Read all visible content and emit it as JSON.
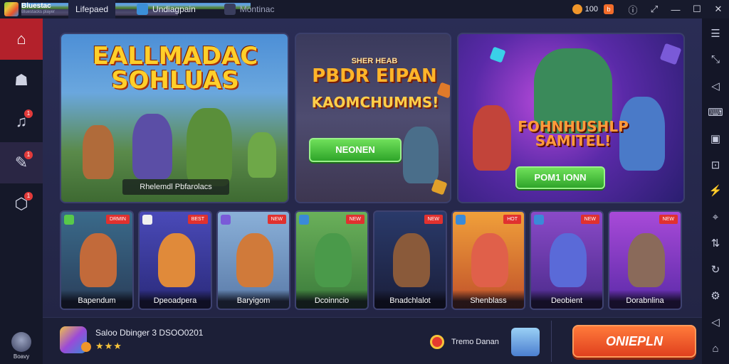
{
  "titlebar": {
    "brand_line1": "Bluestac",
    "brand_line2": "Bluestacks player",
    "tabs": [
      {
        "label": "Lifepaed"
      },
      {
        "label": "Undiagpain"
      },
      {
        "label": "Montinac"
      }
    ],
    "coins": "100"
  },
  "sidebar": {
    "items": [
      {
        "icon": "home-icon",
        "badge": ""
      },
      {
        "icon": "ninja-icon",
        "badge": ""
      },
      {
        "icon": "bell-icon",
        "badge": "1"
      },
      {
        "icon": "chat-icon",
        "badge": "1"
      },
      {
        "icon": "game-icon",
        "badge": "1"
      }
    ],
    "profile_label": "Boavy"
  },
  "banners": [
    {
      "title": "EALLMADAC SOHLUAS",
      "caption": "Rhelemdl Pbfarolacs"
    },
    {
      "title": "PBDR EIPAN",
      "subtitle": "SHER HEAB",
      "title2": "KAOMCHUMMS!",
      "button": "NEONEN"
    },
    {
      "title": "FOHNHUSHLP SAMITEL!",
      "button": "POM1 IONN"
    }
  ],
  "cards": [
    {
      "name": "Bapendum",
      "tag": "DRMIN"
    },
    {
      "name": "Dpeoadpera",
      "tag": "BEST"
    },
    {
      "name": "Baryigom",
      "tag": "NEW"
    },
    {
      "name": "Dcoinncio",
      "tag": "NEW"
    },
    {
      "name": "Bnadchlalot",
      "tag": "NEW"
    },
    {
      "name": "Shenblass",
      "tag": "HOT"
    },
    {
      "name": "Deobient",
      "tag": "NEW"
    },
    {
      "name": "Dorabnlina",
      "tag": "NEW"
    }
  ],
  "bottombar": {
    "app_title": "Saloo Dbinger 3 DSOO0201",
    "stars": "★★★",
    "mid_label": "Tremo Danan",
    "play_button": "ONIEPLN"
  },
  "colors": {
    "accent_red": "#b3212b",
    "play_orange": "#e0401e",
    "cta_green": "#2fa52a",
    "background": "#1b1d33"
  }
}
